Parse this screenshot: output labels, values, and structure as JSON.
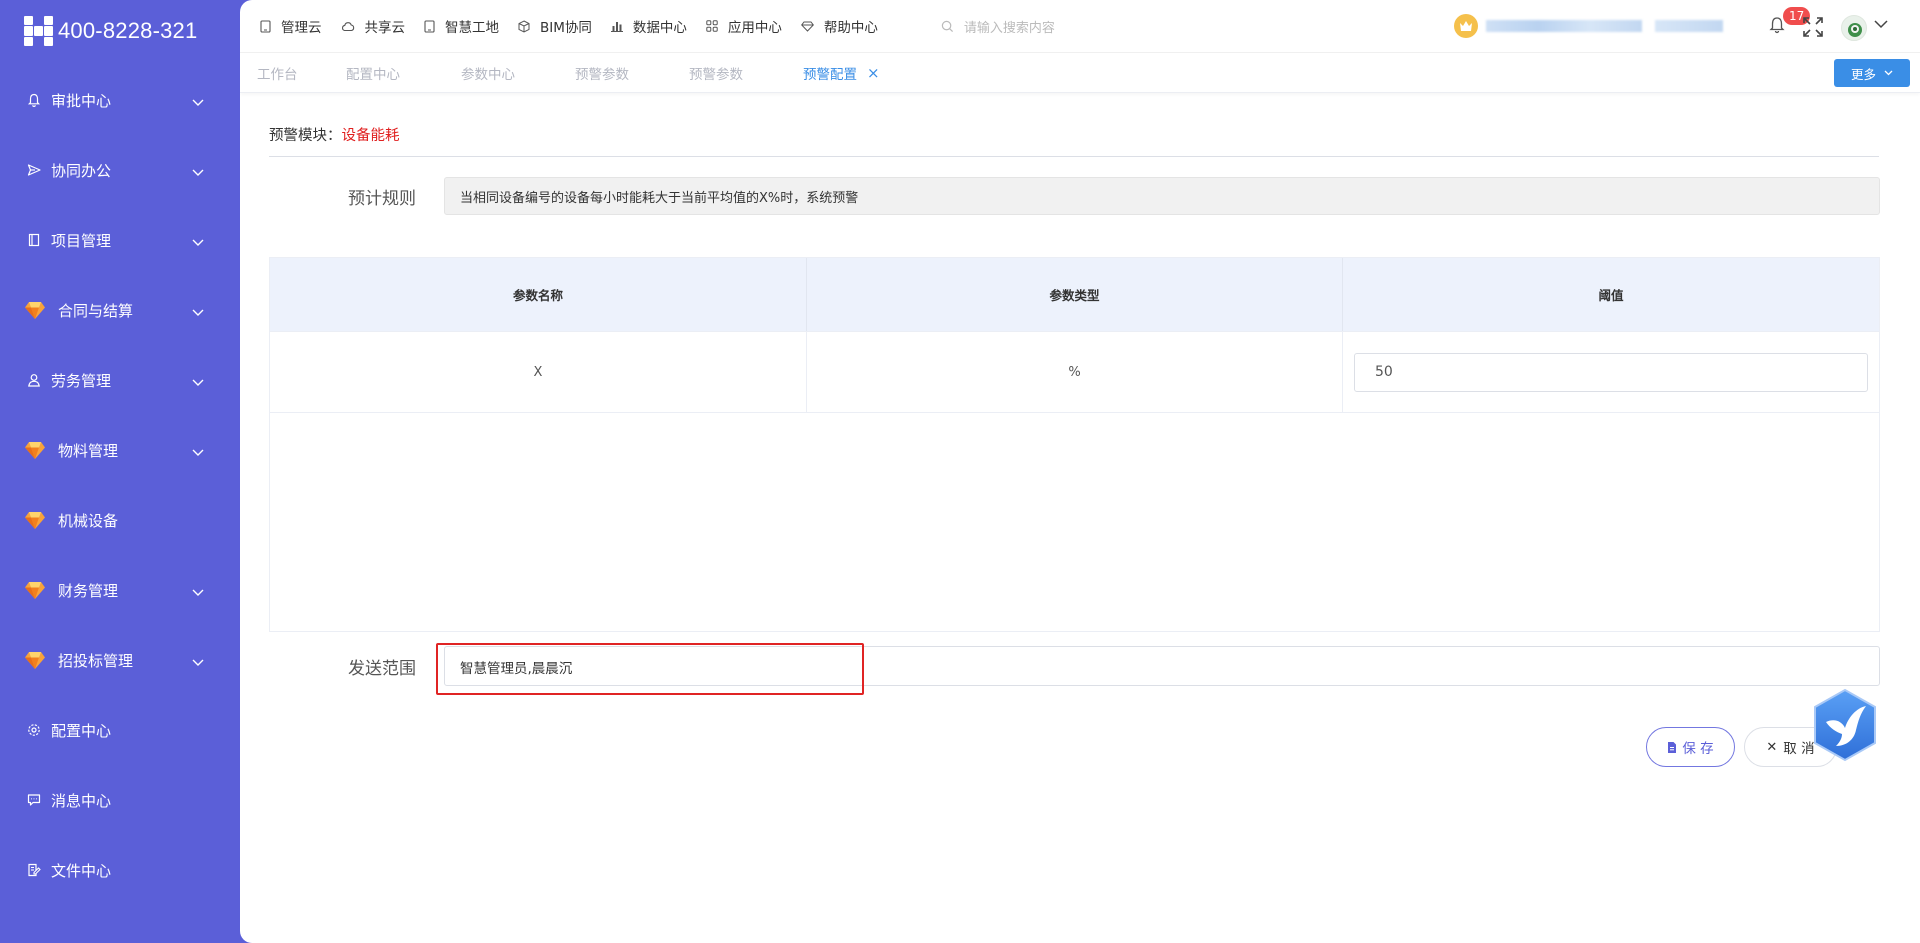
{
  "logo": {
    "phone": "400-8228-321"
  },
  "sidebar": {
    "items": [
      {
        "label": "审批中心",
        "icon": "bell-icon",
        "expandable": true
      },
      {
        "label": "协同办公",
        "icon": "send-icon",
        "expandable": true
      },
      {
        "label": "项目管理",
        "icon": "book-icon",
        "expandable": true
      },
      {
        "label": "合同与结算",
        "icon": "gem-icon",
        "expandable": true
      },
      {
        "label": "劳务管理",
        "icon": "user-icon",
        "expandable": true
      },
      {
        "label": "物料管理",
        "icon": "gem-icon",
        "expandable": true
      },
      {
        "label": "机械设备",
        "icon": "gem-icon",
        "expandable": false
      },
      {
        "label": "财务管理",
        "icon": "gem-icon",
        "expandable": true
      },
      {
        "label": "招投标管理",
        "icon": "gem-icon",
        "expandable": true
      },
      {
        "label": "配置中心",
        "icon": "gear-icon",
        "expandable": false
      },
      {
        "label": "消息中心",
        "icon": "chat-icon",
        "expandable": false
      },
      {
        "label": "文件中心",
        "icon": "file-edit-icon",
        "expandable": false
      }
    ]
  },
  "topnav": {
    "links": [
      {
        "label": "管理云",
        "icon": "tablet-icon"
      },
      {
        "label": "共享云",
        "icon": "cloud-icon"
      },
      {
        "label": "智慧工地",
        "icon": "tablet-icon"
      },
      {
        "label": "BIM协同",
        "icon": "cube-icon"
      },
      {
        "label": "数据中心",
        "icon": "bar-chart-icon"
      },
      {
        "label": "应用中心",
        "icon": "grid-icon"
      },
      {
        "label": "帮助中心",
        "icon": "diamond-icon"
      }
    ],
    "search_placeholder": "请输入搜索内容",
    "notification_count": "17"
  },
  "tabs": [
    {
      "label": "工作台",
      "active": false
    },
    {
      "label": "配置中心",
      "active": false
    },
    {
      "label": "参数中心",
      "active": false
    },
    {
      "label": "预警参数",
      "active": false
    },
    {
      "label": "预警参数",
      "active": false
    },
    {
      "label": "预警配置",
      "active": true
    }
  ],
  "more_button": "更多",
  "form": {
    "module_label": "预警模块：",
    "module_value": "设备能耗",
    "rule_label": "预计规则",
    "rule_text": "当相同设备编号的设备每小时能耗大于当前平均值的X%时，系统预警",
    "table": {
      "headers": [
        "参数名称",
        "参数类型",
        "阈值"
      ],
      "rows": [
        {
          "name": "X",
          "type": "%",
          "threshold": "50"
        }
      ]
    },
    "send_label": "发送范围",
    "send_value": "智慧管理员,晨晨沉"
  },
  "actions": {
    "save": "保 存",
    "cancel": "取 消"
  },
  "colors": {
    "sidebar_bg": "#5b5fd8",
    "accent_blue": "#3a8ee6",
    "highlight_red": "#e02424",
    "warning_red": "#e02020"
  }
}
